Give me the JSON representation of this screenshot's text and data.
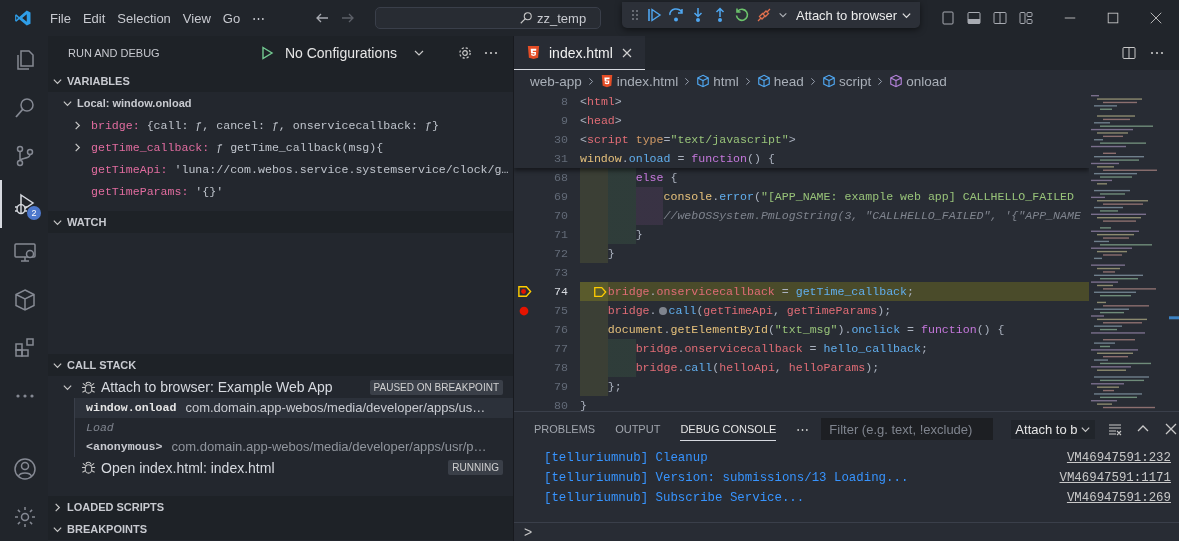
{
  "title_bar": {
    "menu": [
      "File",
      "Edit",
      "Selection",
      "View",
      "Go"
    ],
    "more": "⋯",
    "search": "zz_temp"
  },
  "debug_toolbar": {
    "configuration": "Attach to browser"
  },
  "activity_bar": [
    {
      "kind": "explorer",
      "selected": false
    },
    {
      "kind": "search",
      "selected": false
    },
    {
      "kind": "source-control",
      "selected": false
    },
    {
      "kind": "run-debug",
      "selected": true,
      "badge": "2"
    },
    {
      "kind": "remote",
      "selected": false
    },
    {
      "kind": "box",
      "selected": false
    },
    {
      "kind": "extensions",
      "selected": false
    },
    {
      "kind": "more",
      "selected": false
    },
    {
      "kind": "account",
      "selected": false
    },
    {
      "kind": "manage",
      "selected": false
    }
  ],
  "sidebar": {
    "title": "RUN AND DEBUG",
    "configuration": "No Configurations",
    "variables": {
      "title": "VARIABLES",
      "expanded": true,
      "scope": {
        "label": "Local: window.onload",
        "expanded": true
      },
      "items": [
        {
          "name": "bridge:",
          "value": "{call: ƒ, cancel: ƒ, onservicecallback: ƒ}",
          "expandable": true
        },
        {
          "name": "getTime_callback:",
          "value": "ƒ getTime_callback(msg){",
          "expandable": true
        },
        {
          "name": "getTimeApi:",
          "value": "'luna://com.webos.service.systemservice/clock/g…",
          "expandable": false
        },
        {
          "name": "getTimeParams:",
          "value": "'{}'",
          "expandable": false
        }
      ]
    },
    "watch": {
      "title": "WATCH",
      "expanded": true
    },
    "call_stack": {
      "title": "CALL STACK",
      "expanded": true,
      "sessions": [
        {
          "label": "Attach to browser: Example Web App",
          "status": "PAUSED ON BREAKPOINT",
          "expanded": true,
          "frames": [
            {
              "kind": "frame",
              "name": "window.onload",
              "source": "com.domain.app-webos/media/developer/apps/us…",
              "selected": true
            },
            {
              "kind": "label",
              "name": "Load"
            },
            {
              "kind": "frame",
              "name": "<anonymous>",
              "source": "com.domain.app-webos/media/developer/apps/usr/p…",
              "selected": false
            }
          ]
        },
        {
          "label": "Open index.html: index.html",
          "status": "RUNNING"
        }
      ]
    },
    "loaded_scripts": {
      "title": "LOADED SCRIPTS",
      "expanded": false
    },
    "breakpoints": {
      "title": "BREAKPOINTS",
      "expanded": true
    }
  },
  "editor": {
    "tab": {
      "label": "index.html",
      "selected": true
    },
    "breadcrumbs": [
      {
        "kind": "folder",
        "label": "web-app"
      },
      {
        "kind": "html",
        "label": "index.html"
      },
      {
        "kind": "element",
        "label": "html"
      },
      {
        "kind": "element",
        "label": "head"
      },
      {
        "kind": "element",
        "label": "script"
      },
      {
        "kind": "method",
        "label": "onload"
      }
    ],
    "sticky_lines": [
      {
        "number": "8",
        "tokens": [
          {
            "kind": "punct",
            "text": "<"
          },
          {
            "kind": "tag",
            "text": "html"
          },
          {
            "kind": "punct",
            "text": ">"
          }
        ]
      },
      {
        "number": "9",
        "tokens": [
          {
            "kind": "punct",
            "text": "<"
          },
          {
            "kind": "tag",
            "text": "head"
          },
          {
            "kind": "punct",
            "text": ">"
          }
        ]
      },
      {
        "number": "30",
        "tokens": [
          {
            "kind": "punct",
            "text": "<"
          },
          {
            "kind": "tag",
            "text": "script"
          },
          {
            "kind": "attr",
            "text": " type"
          },
          {
            "kind": "punct",
            "text": "="
          },
          {
            "kind": "string",
            "text": "\"text/javascript\""
          },
          {
            "kind": "punct",
            "text": ">"
          }
        ]
      },
      {
        "number": "31",
        "tokens": [
          {
            "kind": "object",
            "text": "window"
          },
          {
            "kind": "punct",
            "text": "."
          },
          {
            "kind": "func",
            "text": "onload"
          },
          {
            "kind": "punct",
            "text": " = "
          },
          {
            "kind": "keyword",
            "text": "function"
          },
          {
            "kind": "punct",
            "text": "() {"
          }
        ]
      }
    ],
    "lines": [
      {
        "number": "68",
        "current": false,
        "breakpoint": false,
        "tokens": [
          {
            "kind": "keyword",
            "text": "        else"
          },
          {
            "kind": "punct",
            "text": " {"
          }
        ]
      },
      {
        "number": "69",
        "current": false,
        "breakpoint": false,
        "tokens": [
          {
            "kind": "object",
            "text": "            console"
          },
          {
            "kind": "punct",
            "text": "."
          },
          {
            "kind": "func",
            "text": "error"
          },
          {
            "kind": "punct",
            "text": "("
          },
          {
            "kind": "string",
            "text": "\"[APP_NAME: example web app] CALLHELLO_FAILED"
          }
        ]
      },
      {
        "number": "70",
        "current": false,
        "breakpoint": false,
        "tokens": [
          {
            "kind": "comment",
            "text": "            //webOSSystem.PmLogString(3, \"CALLHELLO_FAILED\", '{\"APP_NAME"
          }
        ]
      },
      {
        "number": "71",
        "current": false,
        "breakpoint": false,
        "tokens": [
          {
            "kind": "punct",
            "text": "        }"
          }
        ]
      },
      {
        "number": "72",
        "current": false,
        "breakpoint": false,
        "tokens": [
          {
            "kind": "punct",
            "text": "    }"
          }
        ]
      },
      {
        "number": "73",
        "current": false,
        "breakpoint": false
      },
      {
        "number": "74",
        "current": true,
        "breakpoint": true,
        "tokens": [
          {
            "kind": "frame-arrow"
          },
          {
            "kind": "variable",
            "text": "    bridge"
          },
          {
            "kind": "punct",
            "text": "."
          },
          {
            "kind": "variable",
            "text": "onservicecallback"
          },
          {
            "kind": "punct",
            "text": " = "
          },
          {
            "kind": "func",
            "text": "getTime_callback"
          },
          {
            "kind": "punct",
            "text": ";"
          }
        ]
      },
      {
        "number": "75",
        "current": false,
        "breakpoint": true,
        "tokens": [
          {
            "kind": "variable",
            "text": "    bridge"
          },
          {
            "kind": "punct",
            "text": "."
          },
          {
            "kind": "breakpoint-dot"
          },
          {
            "kind": "func",
            "text": "call"
          },
          {
            "kind": "punct",
            "text": "("
          },
          {
            "kind": "variable",
            "text": "getTimeApi"
          },
          {
            "kind": "punct",
            "text": ", "
          },
          {
            "kind": "variable",
            "text": "getTimeParams"
          },
          {
            "kind": "punct",
            "text": ");"
          }
        ]
      },
      {
        "number": "76",
        "current": false,
        "breakpoint": false,
        "tokens": [
          {
            "kind": "object",
            "text": "    document"
          },
          {
            "kind": "punct",
            "text": "."
          },
          {
            "kind": "object",
            "text": "getElementById"
          },
          {
            "kind": "punct",
            "text": "("
          },
          {
            "kind": "string",
            "text": "\"txt_msg\""
          },
          {
            "kind": "punct",
            "text": ")."
          },
          {
            "kind": "func",
            "text": "onclick"
          },
          {
            "kind": "punct",
            "text": " = "
          },
          {
            "kind": "keyword",
            "text": "function"
          },
          {
            "kind": "punct",
            "text": "() {"
          }
        ]
      },
      {
        "number": "77",
        "current": false,
        "breakpoint": false,
        "tokens": [
          {
            "kind": "variable",
            "text": "        bridge"
          },
          {
            "kind": "punct",
            "text": "."
          },
          {
            "kind": "variable",
            "text": "onservicecallback"
          },
          {
            "kind": "punct",
            "text": " = "
          },
          {
            "kind": "func",
            "text": "hello_callback"
          },
          {
            "kind": "punct",
            "text": ";"
          }
        ]
      },
      {
        "number": "78",
        "current": false,
        "breakpoint": false,
        "tokens": [
          {
            "kind": "variable",
            "text": "        bridge"
          },
          {
            "kind": "punct",
            "text": "."
          },
          {
            "kind": "func",
            "text": "call"
          },
          {
            "kind": "punct",
            "text": "("
          },
          {
            "kind": "variable",
            "text": "helloApi"
          },
          {
            "kind": "punct",
            "text": ", "
          },
          {
            "kind": "variable",
            "text": "helloParams"
          },
          {
            "kind": "punct",
            "text": ");"
          }
        ]
      },
      {
        "number": "79",
        "current": false,
        "breakpoint": false,
        "tokens": [
          {
            "kind": "punct",
            "text": "    };"
          }
        ]
      },
      {
        "number": "80",
        "current": false,
        "breakpoint": false,
        "tokens": [
          {
            "kind": "punct",
            "text": "}"
          }
        ]
      }
    ]
  },
  "panel": {
    "tabs": [
      {
        "label": "PROBLEMS",
        "selected": false
      },
      {
        "label": "OUTPUT",
        "selected": false
      },
      {
        "label": "DEBUG CONSOLE",
        "selected": true
      }
    ],
    "more": "⋯",
    "filter": {
      "placeholder": "Filter (e.g. text, !exclude)"
    },
    "session": "Attach to b",
    "console": [
      {
        "text": "[telluriumnub] Cleanup",
        "source": "VM46947591:232"
      },
      {
        "text": "[telluriumnub] Version: submissions/13 Loading...",
        "source": "VM46947591:1171"
      },
      {
        "text": "[telluriumnub] Subscribe Service...",
        "source": "VM46947591:269"
      }
    ],
    "prompt": ">"
  }
}
